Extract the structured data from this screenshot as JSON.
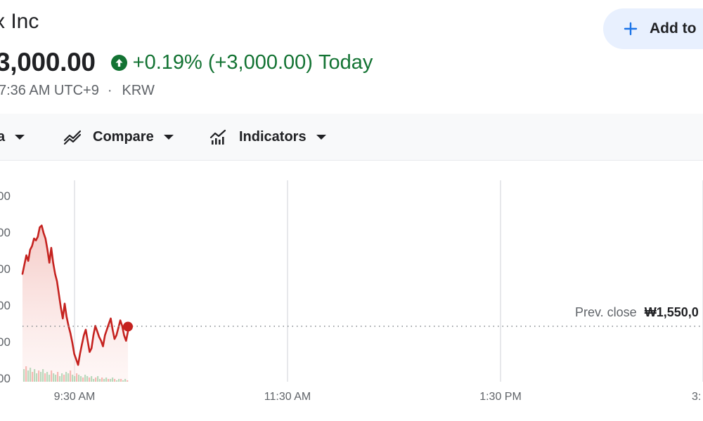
{
  "header": {
    "title": "x Inc",
    "price": "3,000.00",
    "change_percent": "+0.19%",
    "change_abs": "(+3,000.00)",
    "change_period": "Today",
    "meta_time": "7:36 AM UTC+9",
    "meta_separator": "·",
    "meta_currency": "KRW"
  },
  "watchlist_button": {
    "label": "Add to"
  },
  "toolbar": {
    "items": [
      {
        "label": "a",
        "icon": "none"
      },
      {
        "label": "Compare",
        "icon": "compare-icon"
      },
      {
        "label": "Indicators",
        "icon": "indicators-icon"
      }
    ]
  },
  "colors": {
    "positive": "#137333",
    "line": "#c5221f",
    "fill": "#f4c7c3",
    "button_bg": "#e8f0fe",
    "button_icon": "#1a73e8"
  },
  "chart_data": {
    "type": "line",
    "y_tick_labels": [
      "00",
      "00",
      "00",
      "00",
      "00",
      "00"
    ],
    "x_tick_labels": [
      "9:30 AM",
      "11:30 AM",
      "1:30 PM",
      "3:"
    ],
    "prev_close": {
      "label": "Prev. close",
      "value": "₩1,550,0"
    },
    "series": [
      {
        "values": [
          0.58,
          0.63,
          0.68,
          0.65,
          0.71,
          0.73,
          0.77,
          0.76,
          0.78,
          0.83,
          0.84,
          0.8,
          0.77,
          0.71,
          0.64,
          0.72,
          0.64,
          0.58,
          0.54,
          0.47,
          0.4,
          0.34,
          0.42,
          0.35,
          0.3,
          0.26,
          0.21,
          0.15,
          0.12,
          0.09,
          0.15,
          0.2,
          0.25,
          0.28,
          0.22,
          0.16,
          0.18,
          0.25,
          0.3,
          0.27,
          0.24,
          0.22,
          0.19,
          0.25,
          0.28,
          0.31,
          0.34,
          0.28,
          0.23,
          0.25,
          0.29,
          0.33,
          0.3,
          0.25,
          0.22,
          0.27
        ]
      }
    ],
    "volume": [
      9,
      11,
      8,
      10,
      7,
      9,
      6,
      8,
      7,
      9,
      6,
      7,
      5,
      8,
      6,
      5,
      7,
      4,
      6,
      5,
      7,
      6,
      8,
      5,
      4,
      6,
      5,
      4,
      3,
      5,
      4,
      3,
      4,
      2,
      3,
      4,
      2,
      3,
      2,
      3,
      2,
      2,
      3,
      2,
      1,
      2,
      2,
      1,
      2,
      1
    ]
  }
}
